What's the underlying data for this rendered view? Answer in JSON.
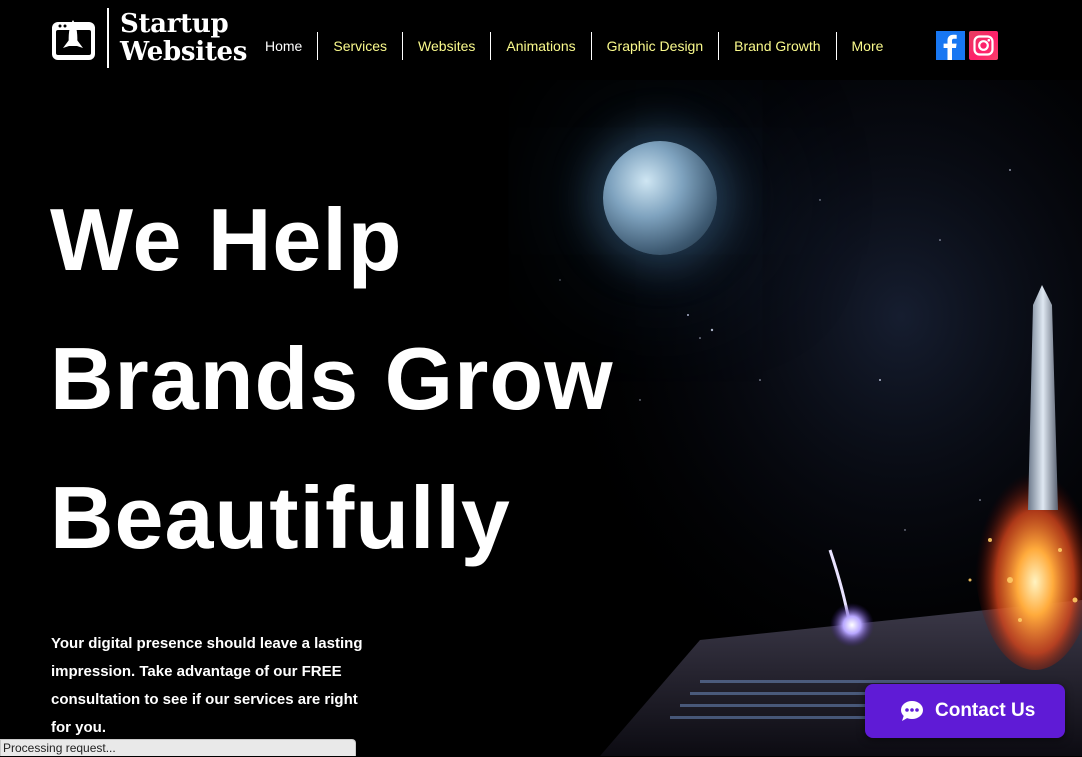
{
  "brand": {
    "line1": "Startup",
    "line2": "Websites",
    "logo_icon": "rocket-browser-icon"
  },
  "nav": {
    "items": [
      {
        "label": "Home"
      },
      {
        "label": "Services"
      },
      {
        "label": "Websites"
      },
      {
        "label": "Animations"
      },
      {
        "label": "Graphic Design"
      },
      {
        "label": "Brand Growth"
      },
      {
        "label": "More"
      }
    ]
  },
  "social": {
    "facebook_icon": "facebook-icon",
    "instagram_icon": "instagram-icon"
  },
  "hero": {
    "headline": [
      "We Help",
      "Brands Grow",
      "Beautifully"
    ],
    "blurb": "Your digital presence should leave a lasting impression. Take advantage of our FREE consultation to see if our services are right for you."
  },
  "contact": {
    "label": "Contact Us",
    "icon": "chat-bubble-icon"
  },
  "status_bar": {
    "text": "Processing request..."
  },
  "colors": {
    "nav_text": "#fafa8c",
    "contact_bg": "#5f1bd6",
    "background": "#000000"
  }
}
